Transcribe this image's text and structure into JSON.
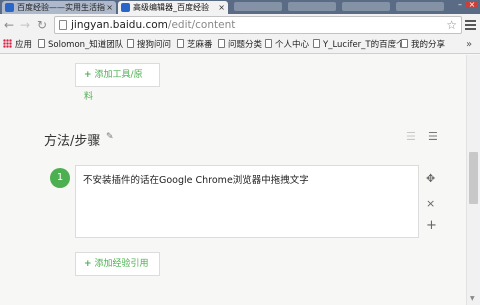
{
  "browser": {
    "tabs": [
      {
        "title": "百度经验——实用生活指",
        "active": false
      },
      {
        "title": "高级编辑器_百度经验",
        "active": true
      }
    ],
    "url_host": "jingyan.baidu.com",
    "url_path": "/edit/content"
  },
  "bookmarks": [
    {
      "label": "应用"
    },
    {
      "label": "Solomon_知道团队"
    },
    {
      "label": "搜狗问问"
    },
    {
      "label": "芝麻番"
    },
    {
      "label": "问题分类"
    },
    {
      "label": "个人中心"
    },
    {
      "label": "Y_Lucifer_T的百度个"
    },
    {
      "label": "我的分享"
    }
  ],
  "editor": {
    "add_tools_label": "添加工具/原料",
    "section_title": "方法/步骤",
    "steps": [
      {
        "number": "1",
        "text": "不安装插件的话在Google Chrome浏览器中拖拽文字"
      }
    ],
    "add_reference_label": "添加经验引用"
  },
  "colors": {
    "accent": "#4caf50"
  }
}
